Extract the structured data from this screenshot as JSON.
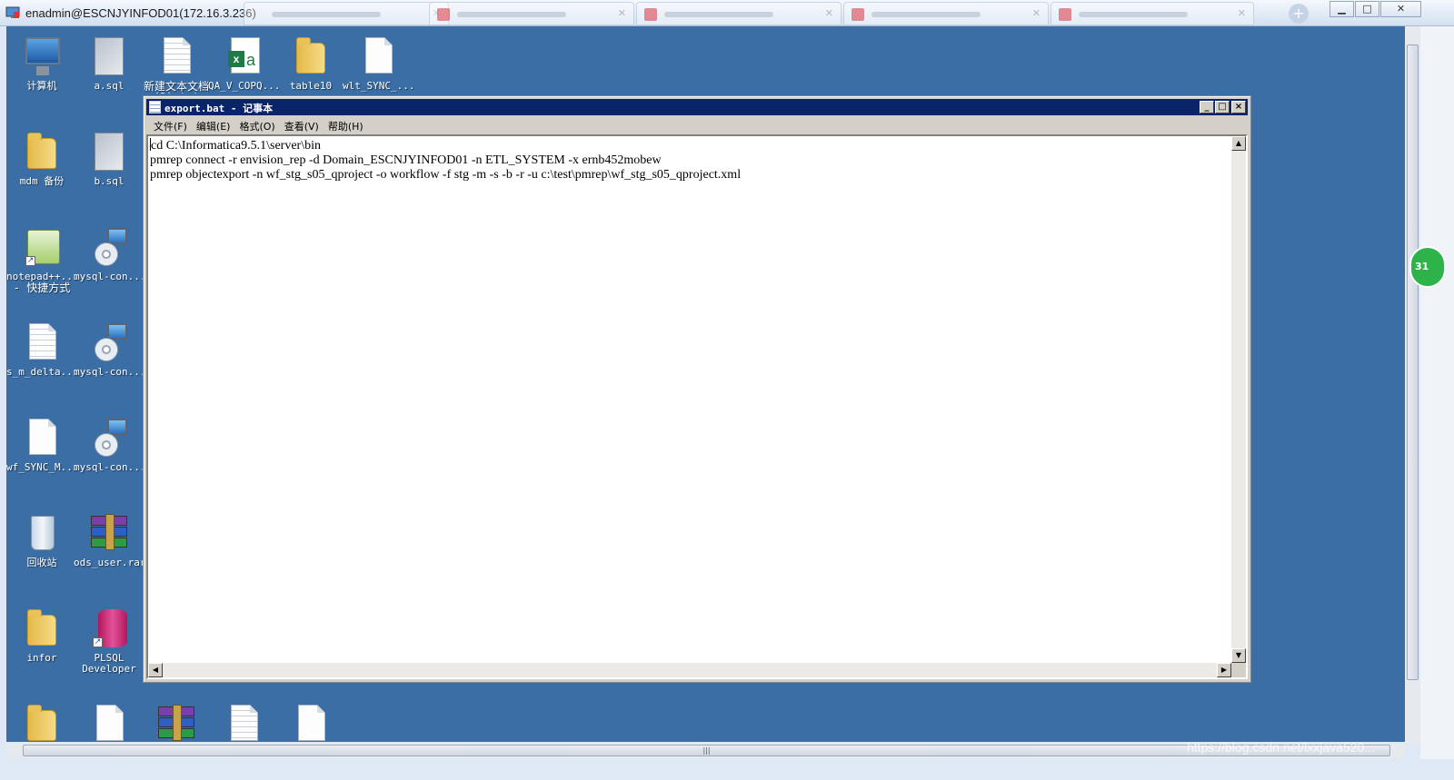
{
  "rdp": {
    "title": "enadmin@ESCNJYINFOD01(172.16.3.236)",
    "tab_plus": "+",
    "buttons": {
      "minimize": "▁",
      "maximize": "□",
      "close": "✕"
    }
  },
  "desktop_icons": [
    {
      "label": "计算机",
      "icon": "computer-icon"
    },
    {
      "label": "a.sql",
      "icon": "sql-file-icon"
    },
    {
      "label": "新建文本文档 (2).txt",
      "icon": "text-file-icon"
    },
    {
      "label": "QA_V_COPQ...",
      "icon": "excel-file-icon"
    },
    {
      "label": "table10",
      "icon": "folder-icon"
    },
    {
      "label": "wlt_SYNC_...",
      "icon": "file-icon"
    },
    {
      "label": "mdm 备份",
      "icon": "folder-icon"
    },
    {
      "label": "b.sql",
      "icon": "sql-file-icon"
    },
    {
      "label": "notepad++...",
      "label2": "- 快捷方式",
      "icon": "notepad-plus-plus-icon"
    },
    {
      "label": "mysql-con...",
      "icon": "installer-icon"
    },
    {
      "label": "s_m_delta...",
      "icon": "text-file-icon"
    },
    {
      "label": "mysql-con...",
      "icon": "installer-icon"
    },
    {
      "label": "wf_SYNC_M...",
      "icon": "file-icon"
    },
    {
      "label": "mysql-con...",
      "icon": "installer-icon"
    },
    {
      "label": "回收站",
      "icon": "recycle-bin-icon"
    },
    {
      "label": "ods_user.rar",
      "icon": "rar-archive-icon"
    },
    {
      "label": "infor",
      "icon": "folder-icon"
    },
    {
      "label": "PLSQL",
      "label2": "Developer",
      "icon": "plsql-developer-icon"
    }
  ],
  "notepad": {
    "title": "export.bat - 记事本",
    "menu": [
      "文件(F)",
      "编辑(E)",
      "格式(O)",
      "查看(V)",
      "帮助(H)"
    ],
    "lines": [
      "cd C:\\Informatica9.5.1\\server\\bin",
      "pmrep connect -r envision_rep -d Domain_ESCNJYINFOD01 -n ETL_SYSTEM -x ernb452mobew",
      "pmrep objectexport -n wf_stg_s05_qproject -o workflow -f stg -m -s -b -r -u c:\\test\\pmrep\\wf_stg_s05_qproject.xml"
    ],
    "controls": {
      "minimize": "_",
      "maximize": "□",
      "close": "×"
    }
  },
  "badge": "31",
  "watermark": "https://blog.csdn.net/lxxjava520..."
}
